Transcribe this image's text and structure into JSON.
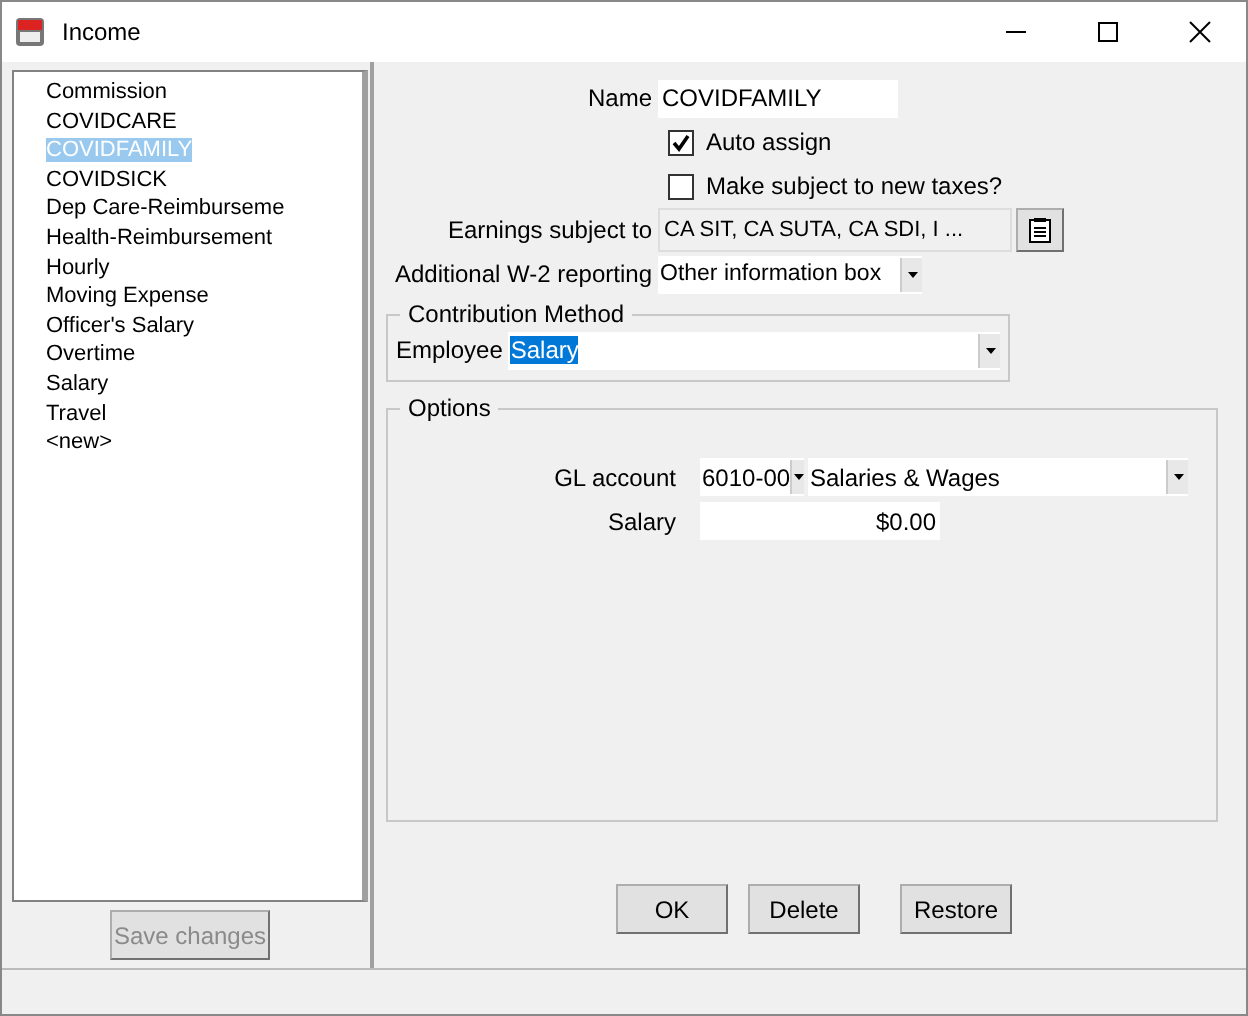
{
  "window": {
    "title": "Income"
  },
  "income_list": {
    "items": [
      {
        "label": "Commission",
        "selected": false
      },
      {
        "label": "COVIDCARE",
        "selected": false
      },
      {
        "label": "COVIDFAMILY",
        "selected": true
      },
      {
        "label": "COVIDSICK",
        "selected": false
      },
      {
        "label": "Dep Care-Reimburseme",
        "selected": false
      },
      {
        "label": "Health-Reimbursement",
        "selected": false
      },
      {
        "label": "Hourly",
        "selected": false
      },
      {
        "label": "Moving Expense",
        "selected": false
      },
      {
        "label": "Officer's Salary",
        "selected": false
      },
      {
        "label": "Overtime",
        "selected": false
      },
      {
        "label": "Salary",
        "selected": false
      },
      {
        "label": "Travel",
        "selected": false
      },
      {
        "label": "<new>",
        "selected": false
      }
    ],
    "save_button": {
      "label": "Save changes",
      "disabled": true
    }
  },
  "form": {
    "name": {
      "label": "Name",
      "value": "COVIDFAMILY"
    },
    "auto_assign": {
      "label": "Auto assign",
      "checked": true
    },
    "new_taxes": {
      "label": "Make subject to new taxes?",
      "checked": false
    },
    "earnings_subject_to": {
      "label": "Earnings subject to",
      "value": "CA SIT, CA SUTA, CA SDI, I ..."
    },
    "w2_reporting": {
      "label": "Additional W-2 reporting",
      "value": "Other information box"
    },
    "contribution_method": {
      "title": "Contribution Method",
      "label": "Employee",
      "value": "Salary"
    },
    "options": {
      "title": "Options",
      "gl_account": {
        "label": "GL account",
        "code": "6010-00",
        "name": "Salaries & Wages"
      },
      "salary": {
        "label": "Salary",
        "value": "$0.00"
      }
    }
  },
  "buttons": [
    {
      "label": "OK"
    },
    {
      "label": "Delete"
    },
    {
      "label": "Restore"
    }
  ]
}
